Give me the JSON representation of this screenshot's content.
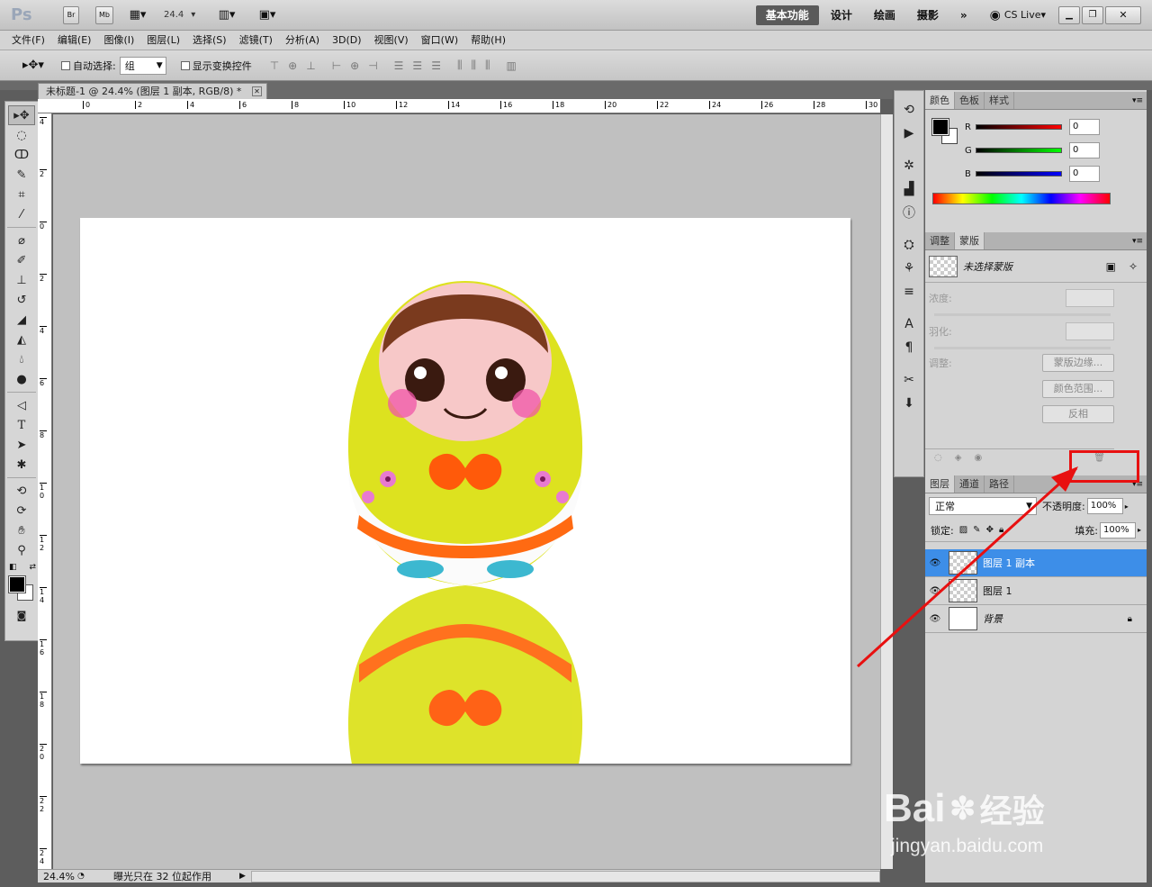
{
  "app": {
    "logo": "Ps",
    "br": "Br",
    "mb": "Mb",
    "zoom_value": "24.4",
    "workspaces": [
      "基本功能",
      "设计",
      "绘画",
      "摄影"
    ],
    "more_workspaces": "»",
    "cs_live": "CS Live"
  },
  "menu": [
    "文件(F)",
    "编辑(E)",
    "图像(I)",
    "图层(L)",
    "选择(S)",
    "滤镜(T)",
    "分析(A)",
    "3D(D)",
    "视图(V)",
    "窗口(W)",
    "帮助(H)"
  ],
  "options": {
    "auto_select_label": "自动选择:",
    "auto_select_value": "组",
    "show_transform_label": "显示变换控件"
  },
  "document": {
    "tab_title": "未标题-1 @ 24.4% (图层 1 副本, RGB/8) *",
    "ruler_h": [
      "0",
      "2",
      "4",
      "6",
      "8",
      "10",
      "12",
      "14",
      "16",
      "18",
      "20",
      "22",
      "24",
      "26",
      "28",
      "30"
    ],
    "ruler_v": [
      "4",
      "2",
      "0",
      "2",
      "4",
      "6",
      "8",
      "1 0",
      "1 2",
      "1 4",
      "1 6",
      "1 8",
      "2 0",
      "2 2",
      "2 4"
    ],
    "status_zoom": "24.4%",
    "status_text": "曝光只在 32 位起作用"
  },
  "color_panel": {
    "tabs": [
      "颜色",
      "色板",
      "样式"
    ],
    "channels": [
      {
        "label": "R",
        "value": "0",
        "color": "#e01010"
      },
      {
        "label": "G",
        "value": "0",
        "color": "#10c010"
      },
      {
        "label": "B",
        "value": "0",
        "color": "#1010e0"
      }
    ]
  },
  "masks_panel": {
    "tabs": [
      "调整",
      "蒙版"
    ],
    "mask_label": "未选择蒙版",
    "density_label": "浓度:",
    "feather_label": "羽化:",
    "adjust_label": "调整:",
    "buttons": [
      "蒙版边缘...",
      "颜色范围...",
      "反相"
    ]
  },
  "layers_panel": {
    "tabs": [
      "图层",
      "通道",
      "路径"
    ],
    "blend_mode": "正常",
    "opacity_label": "不透明度:",
    "opacity_value": "100%",
    "lock_label": "锁定:",
    "fill_label": "填充:",
    "fill_value": "100%",
    "layers": [
      {
        "name": "图层 1 副本",
        "selected": true
      },
      {
        "name": "图层 1",
        "selected": false
      },
      {
        "name": "背景",
        "selected": false
      }
    ]
  },
  "watermark": {
    "brand": "Bai",
    "brand_cn": "经验",
    "url": "jingyan.baidu.com"
  },
  "colors": {
    "highlight": "#e81010",
    "selection": "#3d8ee8"
  }
}
